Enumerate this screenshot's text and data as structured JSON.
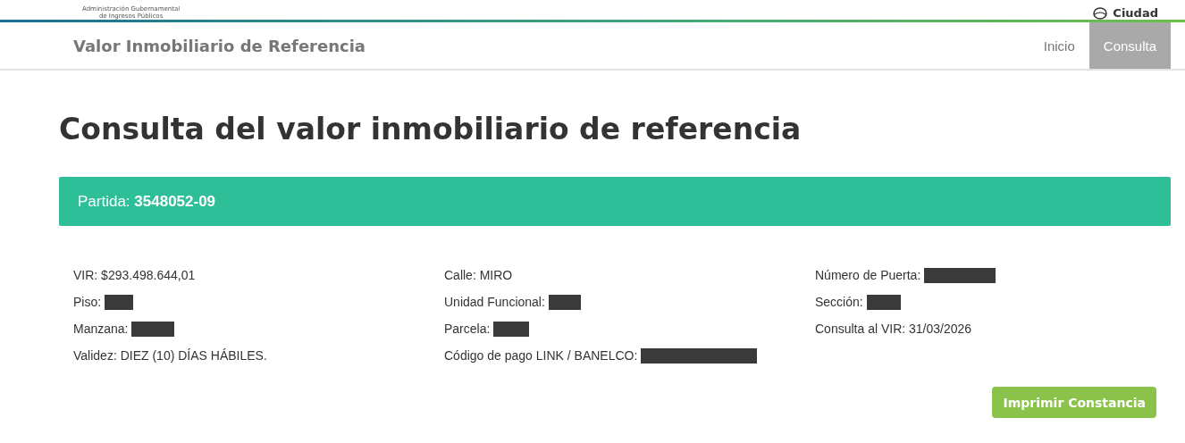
{
  "top_bar": {
    "agency_lines": [
      "Administración Gubernamental",
      "de Ingresos Públicos"
    ],
    "city_label": "Ciudad"
  },
  "navbar": {
    "title": "Valor Inmobiliario de Referencia",
    "links": [
      {
        "label": "Inicio",
        "selected": false
      },
      {
        "label": "Consulta",
        "selected": true
      }
    ]
  },
  "heading": "Consulta del valor inmobiliario de referencia",
  "partida": {
    "label": "Partida:",
    "value": "3548052-09"
  },
  "columns": [
    [
      {
        "label": "VIR:",
        "value": "$293.498.644,01",
        "redacted": false
      },
      {
        "label": "Piso:",
        "redacted": true
      },
      {
        "label": "Manzana:",
        "redacted": true
      },
      {
        "label": "Validez:",
        "value": "DIEZ (10) DÍAS HÁBILES.",
        "redacted": false
      }
    ],
    [
      {
        "label": "Calle:",
        "value": "MIRO",
        "redacted": false
      },
      {
        "label": "Unidad Funcional:",
        "redacted": true
      },
      {
        "label": "Parcela:",
        "redacted": true
      },
      {
        "label": "Código de pago LINK / BANELCO:",
        "redacted": true
      }
    ],
    [
      {
        "label": "Número de Puerta:",
        "redacted": true
      },
      {
        "label": "Sección:",
        "redacted": true
      },
      {
        "label": "Consulta al VIR:",
        "value": "31/03/2026",
        "redacted": false
      }
    ]
  ],
  "print_button": "Imprimir Constancia"
}
